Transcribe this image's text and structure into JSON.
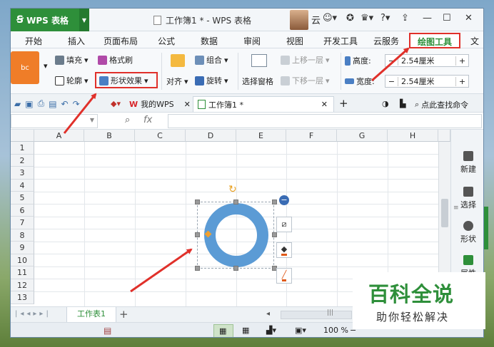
{
  "titlebar": {
    "app_name": "WPS 表格",
    "doc_title": "工作簿1 * - WPS 表格",
    "user_name": "云"
  },
  "menu": {
    "items": [
      "开始",
      "插入",
      "页面布局",
      "公式",
      "数据",
      "审阅",
      "视图",
      "开发工具",
      "云服务",
      "绘图工具",
      "文"
    ]
  },
  "ribbon": {
    "preset_label": "bc",
    "fill": "填充",
    "format_painter": "格式刷",
    "outline": "轮廓",
    "shape_effects": "形状效果",
    "align": "对齐",
    "group": "组合",
    "rotate": "旋转",
    "selection_pane": "选择窗格",
    "bring_forward": "上移一层",
    "send_backward": "下移一层",
    "height_label": "高度:",
    "width_label": "宽度:",
    "height_value": "2.54厘米",
    "width_value": "2.54厘米"
  },
  "tabs": {
    "mywps": "我的WPS",
    "workbook": "工作簿1 *",
    "find_command": "点此查找命令"
  },
  "formula": {
    "fx": "fx"
  },
  "grid": {
    "columns": [
      "A",
      "B",
      "C",
      "D",
      "E",
      "F",
      "G",
      "H"
    ],
    "rows": [
      "1",
      "2",
      "3",
      "4",
      "5",
      "6",
      "7",
      "8",
      "9",
      "10",
      "11",
      "12",
      "13"
    ]
  },
  "right_panel": {
    "new": "新建",
    "select": "选择",
    "shapes": "形状",
    "properties": "属性"
  },
  "sheet": {
    "name": "工作表1"
  },
  "status": {
    "zoom": "100 %"
  },
  "watermark": {
    "title": "百科全说",
    "subtitle": "助你轻松解决"
  },
  "colors": {
    "accent": "#2e8f3a",
    "ring": "#5b9bd5",
    "highlight": "#e0302a"
  }
}
